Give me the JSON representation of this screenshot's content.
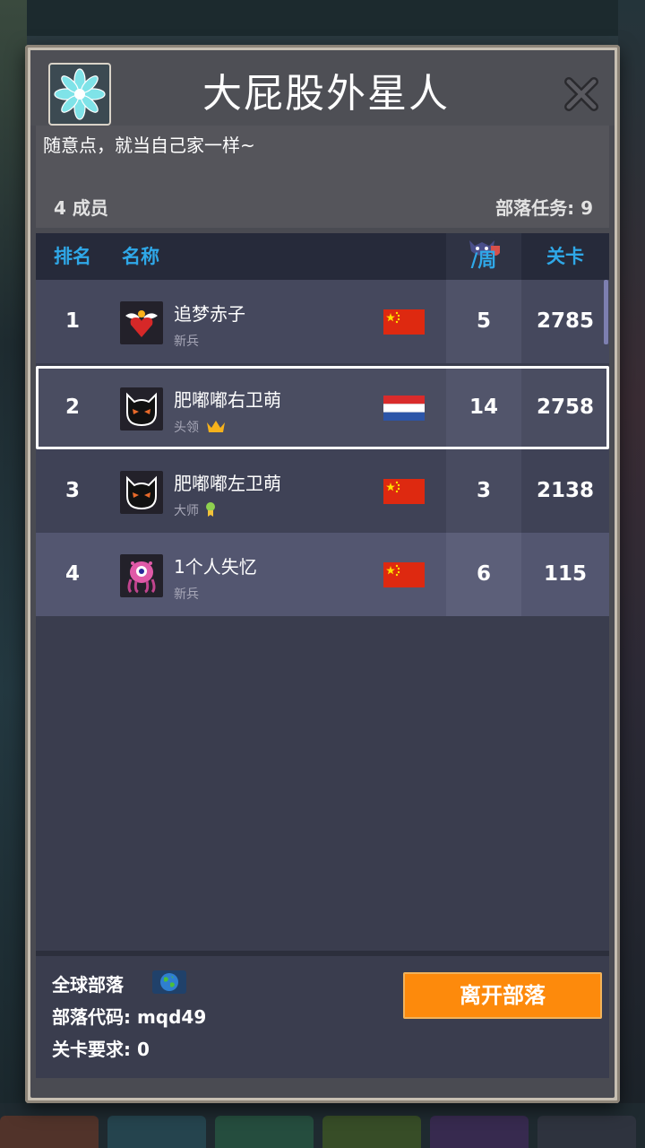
{
  "header": {
    "title": "大屁股外星人",
    "description": "随意点，就当自己家一样~",
    "member_count": "4 成员",
    "task_label": "部落任务: 9"
  },
  "table": {
    "headers": {
      "rank": "排名",
      "name": "名称",
      "week": "/周",
      "stage": "关卡"
    },
    "rows": [
      {
        "rank": "1",
        "name": "追梦赤子",
        "role": "新兵",
        "flag": "china",
        "week": "5",
        "stage": "2785"
      },
      {
        "rank": "2",
        "name": "肥嘟嘟右卫萌",
        "role": "头领",
        "flag": "netherlands",
        "week": "14",
        "stage": "2758"
      },
      {
        "rank": "3",
        "name": "肥嘟嘟左卫萌",
        "role": "大师",
        "flag": "china",
        "week": "3",
        "stage": "2138"
      },
      {
        "rank": "4",
        "name": "1个人失忆",
        "role": "新兵",
        "flag": "china",
        "week": "6",
        "stage": "115"
      }
    ]
  },
  "footer": {
    "global_tribe": "全球部落",
    "tribe_code": "部落代码: mqd49",
    "stage_requirement": "关卡要求:  0",
    "leave_button": "离开部落"
  },
  "colors": {
    "accent_blue": "#2fa8e8",
    "leave_orange": "#fd8a0c",
    "flag_red": "#de2910",
    "flag_star": "#ffde00"
  }
}
